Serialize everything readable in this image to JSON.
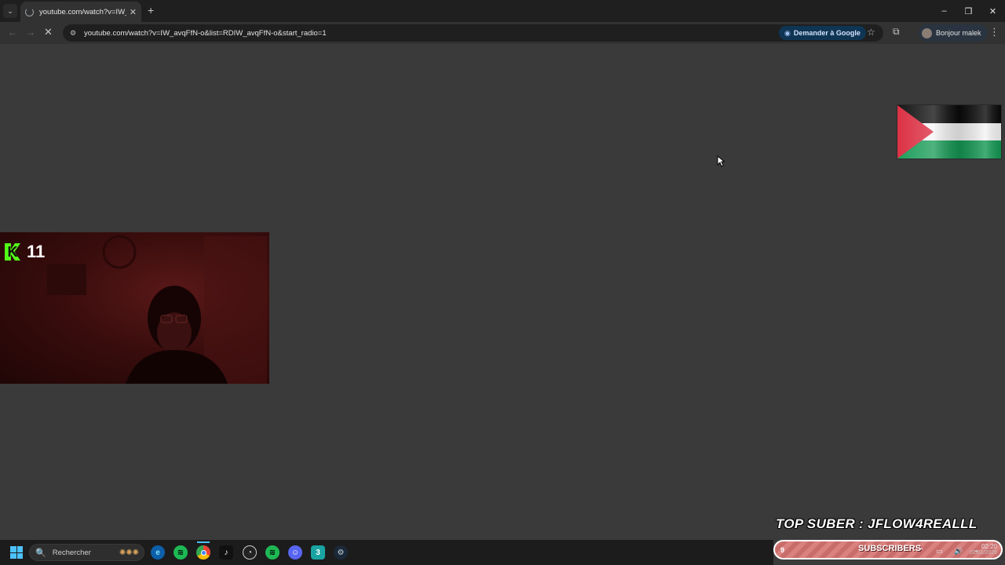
{
  "browser": {
    "tab_title": "youtube.com/watch?v=IW_avq",
    "url": "youtube.com/watch?v=IW_avqFfN-o&list=RDIW_avqFfN-o&start_radio=1",
    "ask_google_label": "Demander à Google",
    "profile_label": "Bonjour malek",
    "tab_menu_glyph": "⌄",
    "tab_close_glyph": "✕",
    "new_tab_glyph": "+",
    "back_glyph": "←",
    "forward_glyph": "→",
    "reload_glyph": "✕",
    "site_info_glyph": "⚙",
    "star_glyph": "☆",
    "extensions_glyph": "⧉",
    "menu_glyph": "⋮",
    "window_controls": {
      "minimize": "–",
      "restore": "❐",
      "close": "✕"
    }
  },
  "overlay": {
    "viewer_count": "11",
    "kick_logo_letter": "K",
    "top_suber_text": "TOP SUBER : JFLOW4REALLL",
    "subs_count": "9",
    "subs_label": "SUBSCRIBERS"
  },
  "taskbar": {
    "search_placeholder": "Rechercher",
    "search_icon": "🔍",
    "search_deco": "✺✺✺",
    "apps": [
      "edge-icon",
      "spotify-icon",
      "chrome-icon",
      "tiktok-icon",
      "obs-icon",
      "spotify-icon",
      "discord-icon",
      "app-icon",
      "steam-icon"
    ],
    "time": "02:20",
    "date": "02/01/2026",
    "tray_glyphs": "⌃ ▭ 🔊 ⌁"
  },
  "colors": {
    "flag_black": "#000000",
    "flag_white": "#ffffff",
    "flag_green": "#149954",
    "flag_red": "#e4312b",
    "kick_green": "#53fc18",
    "subs_bar": "#d9827f"
  }
}
